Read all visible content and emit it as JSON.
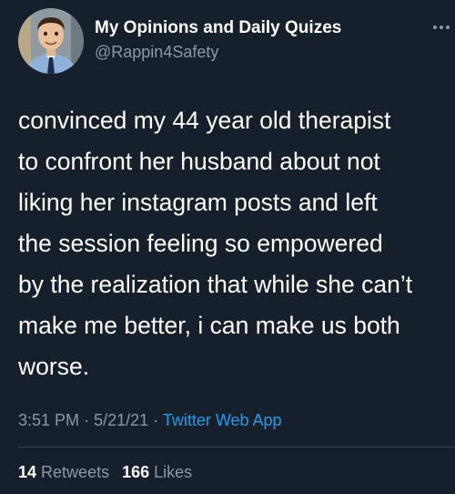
{
  "tweet": {
    "author": {
      "display_name": "My Opinions and Daily Quizes",
      "handle": "@Rappin4Safety"
    },
    "text": "convinced my 44 year old therapist\nto confront her husband about not\nliking her instagram posts and left\nthe session feeling so empowered\nby the realization that while she can’t\nmake me better, i can make us both\nworse.",
    "time": "3:51 PM",
    "separator": "·",
    "date": "5/21/21",
    "source": "Twitter Web App",
    "retweets_count": "14",
    "retweets_label": "Retweets",
    "likes_count": "166",
    "likes_label": "Likes"
  },
  "icons": {
    "more": "more-options-icon",
    "avatar": "avatar"
  },
  "colors": {
    "background": "#15202b",
    "text": "#ffffff",
    "secondary": "#8b98a5",
    "link": "#1d9bf0",
    "divider": "#38444d"
  }
}
